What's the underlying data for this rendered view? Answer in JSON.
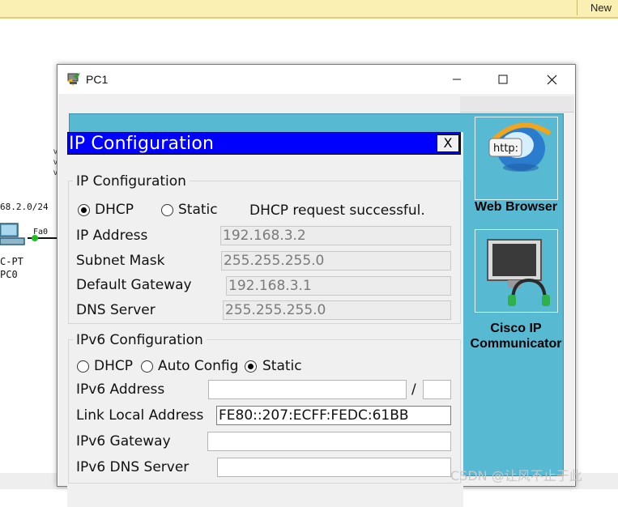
{
  "workspace": {
    "new_button_label": "New",
    "network_labels": [
      "68.2.0/24",
      "Fa0",
      "C-PT",
      "PC0"
    ],
    "side_letters": [
      "v",
      "v",
      "v"
    ]
  },
  "window": {
    "title": "PC1",
    "minimize_glyph": "—",
    "maximize_glyph": "☐",
    "close_glyph": "✕"
  },
  "desktop": {
    "apps": [
      {
        "label": "Web Browser",
        "icon": "web-browser-icon",
        "icon_text": "http:"
      },
      {
        "label": "Cisco IP Communicator",
        "icon": "ip-communicator-icon"
      }
    ],
    "background_color": "#58b9d3"
  },
  "ip_config": {
    "title": "IP Configuration",
    "close_label": "X",
    "title_bar_color": "#0000ff",
    "ipv4": {
      "legend": "IP Configuration",
      "dhcp_label": "DHCP",
      "static_label": "Static",
      "mode": "DHCP",
      "status": "DHCP request successful.",
      "ip_address_label": "IP Address",
      "ip_address": "192.168.3.2",
      "subnet_mask_label": "Subnet Mask",
      "subnet_mask": "255.255.255.0",
      "default_gateway_label": "Default Gateway",
      "default_gateway": "192.168.3.1",
      "dns_server_label": "DNS Server",
      "dns_server": "255.255.255.0"
    },
    "ipv6": {
      "legend": "IPv6 Configuration",
      "dhcp_label": "DHCP",
      "auto_label": "Auto Config",
      "static_label": "Static",
      "mode": "Static",
      "address_label": "IPv6 Address",
      "address": "",
      "prefix_separator": "/",
      "prefix": "",
      "link_local_label": "Link Local Address",
      "link_local": "FE80::207:ECFF:FEDC:61BB",
      "gateway_label": "IPv6 Gateway",
      "gateway": "",
      "dns_label": "IPv6 DNS Server",
      "dns": ""
    }
  },
  "watermark": "CSDN @让风不止于此"
}
